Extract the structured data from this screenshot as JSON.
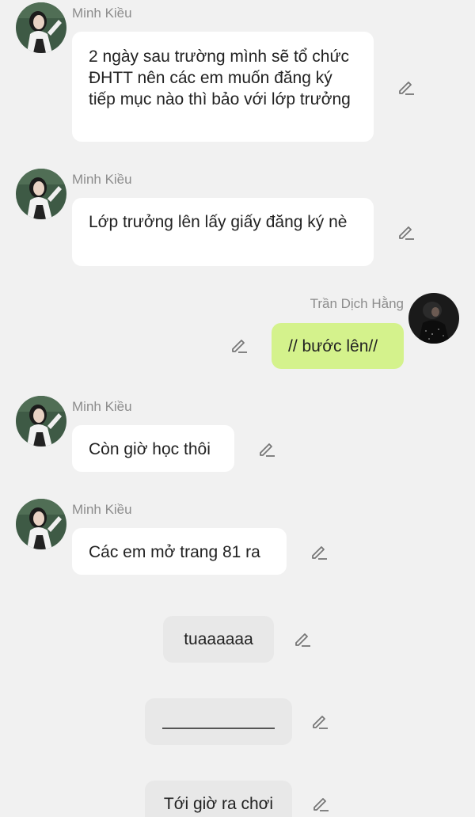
{
  "messages": [
    {
      "sender": "Minh Kiều",
      "text": "2 ngày sau trường mình sẽ tổ chức ĐHTT  nên các em muốn đăng ký tiếp mục nào thì bảo với lớp trưởng"
    },
    {
      "sender": "Minh Kiều",
      "text": "Lớp trưởng lên lấy giấy đăng ký nè"
    },
    {
      "sender": "Trần Dịch Hằng",
      "text": "// bước lên//"
    },
    {
      "sender": "Minh Kiều",
      "text": "Còn giờ học thôi"
    },
    {
      "sender": "Minh Kiều",
      "text": "Các em mở trang 81 ra"
    },
    {
      "text": "tuaaaaaa"
    },
    {
      "text": ""
    },
    {
      "text": "Tới giờ ra chơi"
    }
  ],
  "icons": {
    "edit": "pencil-edit-icon"
  },
  "colors": {
    "background": "#f1f1f1",
    "bubble_incoming": "#ffffff",
    "bubble_outgoing": "#d4f28c",
    "bubble_neutral": "#e8e8e8",
    "sender_name": "#8c8c8c"
  }
}
